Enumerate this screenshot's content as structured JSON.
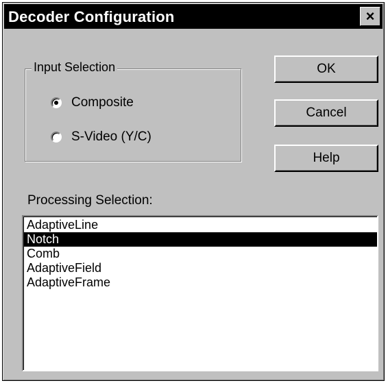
{
  "window": {
    "title": "Decoder Configuration",
    "close_label": "×"
  },
  "input_selection": {
    "legend": "Input Selection",
    "options": [
      {
        "label": "Composite",
        "checked": true
      },
      {
        "label": "S-Video (Y/C)",
        "checked": false
      }
    ]
  },
  "buttons": {
    "ok": "OK",
    "cancel": "Cancel",
    "help": "Help"
  },
  "processing": {
    "label": "Processing Selection:",
    "items": [
      {
        "label": "AdaptiveLine",
        "selected": false
      },
      {
        "label": "Notch",
        "selected": true
      },
      {
        "label": "Comb",
        "selected": false
      },
      {
        "label": "AdaptiveField",
        "selected": false
      },
      {
        "label": "AdaptiveFrame",
        "selected": false
      }
    ]
  }
}
